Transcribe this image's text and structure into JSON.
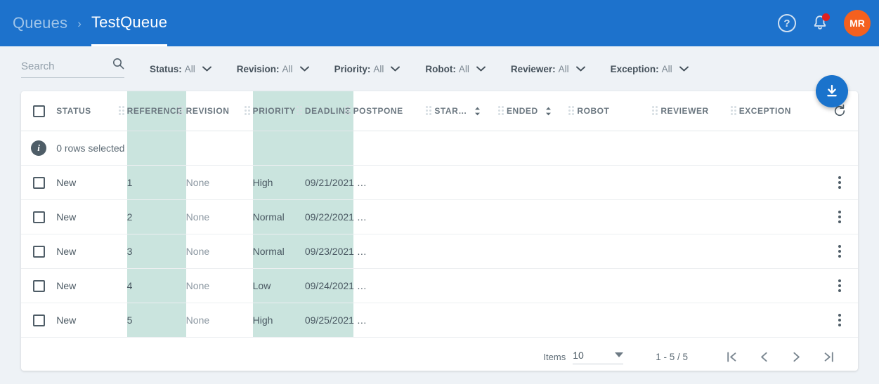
{
  "appbar": {
    "breadcrumb_root": "Queues",
    "breadcrumb_separator": "›",
    "breadcrumb_current": "TestQueue",
    "help_label": "?",
    "avatar_initials": "MR",
    "colors": {
      "bar": "#1d72cc",
      "avatar": "#f4601e",
      "notification_dot": "#e02020"
    },
    "icons": {
      "help": "help-icon",
      "bell": "notifications-bell-icon",
      "avatar": "user-avatar"
    }
  },
  "filters": {
    "search_placeholder": "Search",
    "search_value": "",
    "items": [
      {
        "label": "Status:",
        "value": "All"
      },
      {
        "label": "Revision:",
        "value": "All"
      },
      {
        "label": "Priority:",
        "value": "All"
      },
      {
        "label": "Robot:",
        "value": "All"
      },
      {
        "label": "Reviewer:",
        "value": "All"
      },
      {
        "label": "Exception:",
        "value": "All"
      }
    ]
  },
  "fab": {
    "icon": "download-icon",
    "color": "#1a73cc"
  },
  "table": {
    "refresh_icon": "refresh-icon",
    "info_row": {
      "icon": "info-icon",
      "text": "0 rows selected"
    },
    "highlight_color": "#cae4de",
    "columns": [
      {
        "key": "status",
        "label": "STATUS",
        "highlight": false,
        "sortable": false
      },
      {
        "key": "reference",
        "label": "REFERENCE",
        "highlight": true,
        "sortable": false
      },
      {
        "key": "revision",
        "label": "REVISION",
        "highlight": false,
        "sortable": false
      },
      {
        "key": "priority",
        "label": "PRIORITY",
        "highlight": true,
        "sortable": false
      },
      {
        "key": "deadline",
        "label": "DEADLINE",
        "highlight": true,
        "sortable": false
      },
      {
        "key": "postpone",
        "label": "POSTPONE",
        "highlight": false,
        "sortable": false
      },
      {
        "key": "started",
        "label": "STAR…",
        "highlight": false,
        "sortable": true
      },
      {
        "key": "ended",
        "label": "ENDED",
        "highlight": false,
        "sortable": true
      },
      {
        "key": "robot",
        "label": "ROBOT",
        "highlight": false,
        "sortable": false
      },
      {
        "key": "reviewer",
        "label": "REVIEWER",
        "highlight": false,
        "sortable": false
      },
      {
        "key": "exception",
        "label": "EXCEPTION",
        "highlight": false,
        "sortable": false
      }
    ],
    "rows": [
      {
        "status": "New",
        "reference": "1",
        "revision": "None",
        "priority": "High",
        "deadline": "09/21/2021 …",
        "postpone": "",
        "started": "",
        "ended": "",
        "robot": "",
        "reviewer": "",
        "exception": ""
      },
      {
        "status": "New",
        "reference": "2",
        "revision": "None",
        "priority": "Normal",
        "deadline": "09/22/2021 …",
        "postpone": "",
        "started": "",
        "ended": "",
        "robot": "",
        "reviewer": "",
        "exception": ""
      },
      {
        "status": "New",
        "reference": "3",
        "revision": "None",
        "priority": "Normal",
        "deadline": "09/23/2021 …",
        "postpone": "",
        "started": "",
        "ended": "",
        "robot": "",
        "reviewer": "",
        "exception": ""
      },
      {
        "status": "New",
        "reference": "4",
        "revision": "None",
        "priority": "Low",
        "deadline": "09/24/2021 …",
        "postpone": "",
        "started": "",
        "ended": "",
        "robot": "",
        "reviewer": "",
        "exception": ""
      },
      {
        "status": "New",
        "reference": "5",
        "revision": "None",
        "priority": "High",
        "deadline": "09/25/2021 …",
        "postpone": "",
        "started": "",
        "ended": "",
        "robot": "",
        "reviewer": "",
        "exception": ""
      }
    ]
  },
  "pagination": {
    "items_label": "Items",
    "items_per_page": "10",
    "range": "1 - 5 / 5",
    "buttons": [
      "first-page",
      "previous-page",
      "next-page",
      "last-page"
    ]
  }
}
